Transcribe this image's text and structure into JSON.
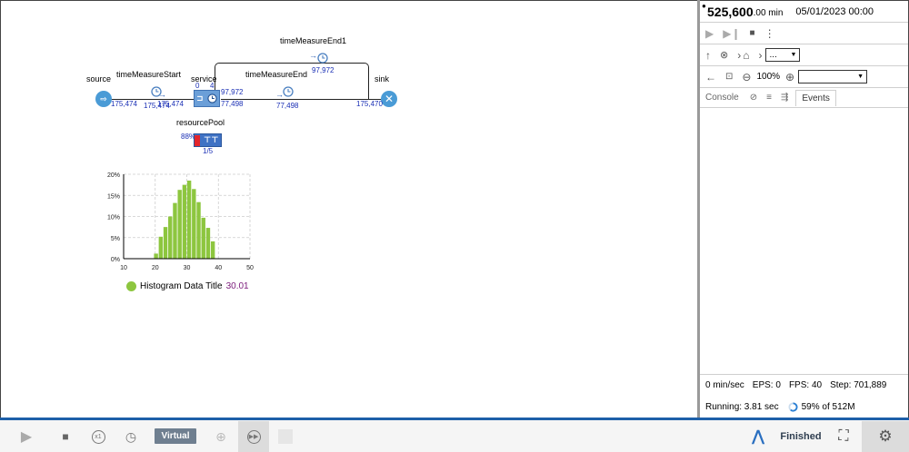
{
  "model": {
    "source": {
      "label": "source",
      "count": "175,474"
    },
    "timeMeasureStart": {
      "label": "timeMeasureStart",
      "count": "175,474"
    },
    "service": {
      "label": "service",
      "count_in": "175,474",
      "queue": "0",
      "capacity": "4",
      "out_top": "97,972",
      "out_bottom": "77,498"
    },
    "timeMeasureEnd": {
      "label": "timeMeasureEnd",
      "count": "77,498"
    },
    "timeMeasureEnd1": {
      "label": "timeMeasureEnd1",
      "count": "97,972"
    },
    "sink": {
      "label": "sink",
      "count": "175,470"
    },
    "resourcePool": {
      "label": "resourcePool",
      "utilization": "88%",
      "busy": "1/5"
    }
  },
  "histogram": {
    "legend_label": "Histogram Data Title",
    "legend_value": "30.01",
    "legend_color": "#8dc63f",
    "value_color": "#7a1a7a"
  },
  "chart_data": {
    "type": "bar",
    "x_ticks": [
      "10",
      "20",
      "30",
      "40",
      "50"
    ],
    "y_ticks": [
      "0%",
      "5%",
      "10%",
      "15%",
      "20%"
    ],
    "xlim": [
      10,
      50
    ],
    "ylim": [
      0,
      20
    ],
    "grid": true,
    "legend": "bottom",
    "bin_width": 1.5,
    "bins_start": [
      19.5,
      21.0,
      22.5,
      24.0,
      25.5,
      27.0,
      28.5,
      30.0,
      31.5,
      33.0,
      34.5,
      36.0,
      37.5
    ],
    "values": [
      1.2,
      5.2,
      7.5,
      10.0,
      13.2,
      16.3,
      17.5,
      18.5,
      16.5,
      13.4,
      9.7,
      7.3,
      4.1
    ],
    "series": [
      {
        "name": "Histogram Data Title",
        "color": "#8dc63f"
      }
    ]
  },
  "panel": {
    "time_value": "525,600",
    "time_unit": ".00 min",
    "date": "05/01/2023 00:00",
    "zoom": "100%",
    "crumb_select": "...",
    "tabs": {
      "console": "Console",
      "events": "Events"
    },
    "status": {
      "speed": "0 min/sec",
      "eps": "EPS: 0",
      "fps": "FPS: 40",
      "step": "Step: 701,889",
      "running": "Running: 3.81 sec",
      "memory": "59% of 512M"
    }
  },
  "toolbar": {
    "virtual_label": "Virtual",
    "speed_label": "x1",
    "finished_label": "Finished"
  }
}
